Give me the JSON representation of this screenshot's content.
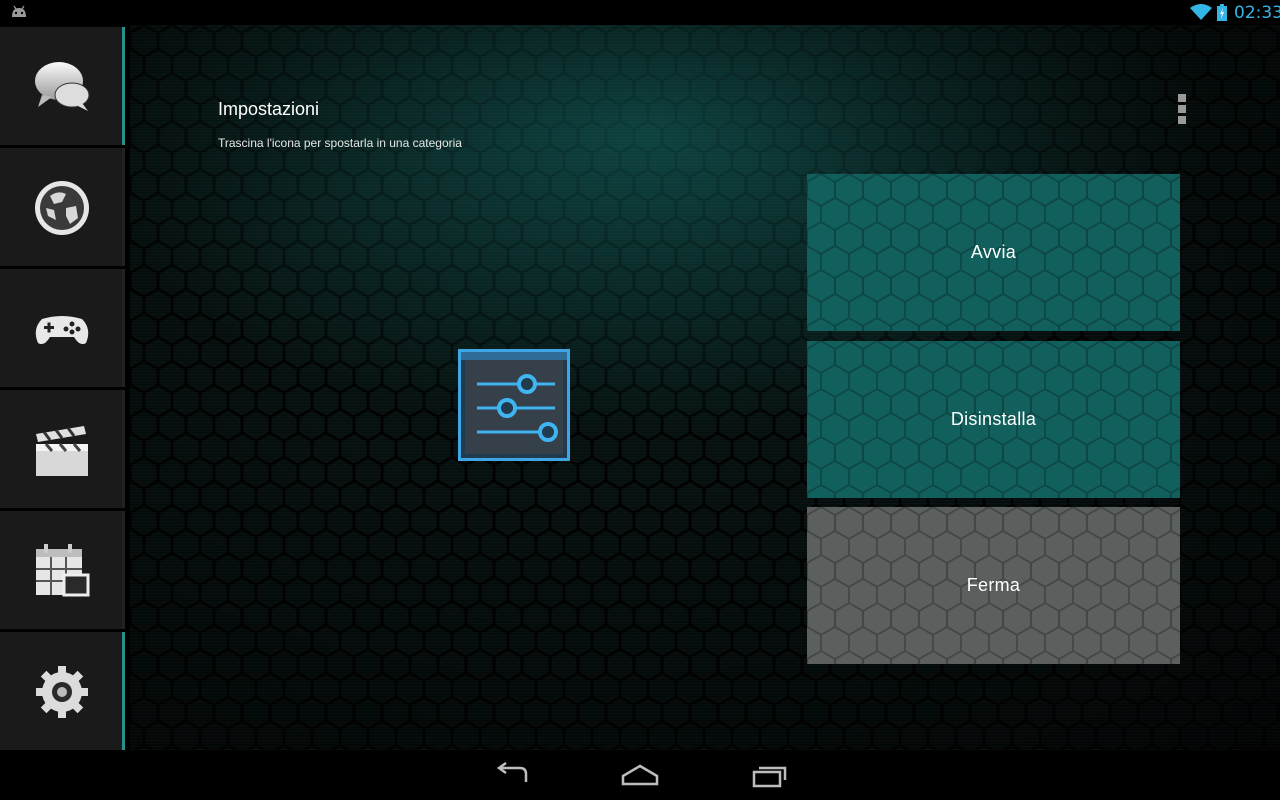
{
  "status_bar": {
    "time": "02:33",
    "left_icon": "android-icon",
    "icons": [
      "wifi-icon",
      "battery-charging-icon"
    ],
    "accent": "#33b5e5"
  },
  "sidebar": {
    "items": [
      {
        "name": "chat",
        "icon": "chat-bubbles-icon"
      },
      {
        "name": "internet",
        "icon": "globe-icon"
      },
      {
        "name": "games",
        "icon": "gamepad-icon"
      },
      {
        "name": "media",
        "icon": "clapperboard-icon"
      },
      {
        "name": "tools",
        "icon": "calendar-grid-icon"
      },
      {
        "name": "settings",
        "icon": "gear-icon"
      }
    ]
  },
  "header": {
    "title": "Impostazioni",
    "subtitle": "Trascina l'icona per spostarla in una categoria"
  },
  "dragged_app": {
    "icon": "settings-sliders-icon"
  },
  "actions": {
    "start": "Avvia",
    "uninstall": "Disinstalla",
    "stop": "Ferma"
  },
  "colors": {
    "drop_teal": "#12605d",
    "drop_gray": "#5b5f5e",
    "sidebar_accent": "#2b8f8c"
  },
  "nav_bar": {
    "buttons": [
      "back-icon",
      "home-icon",
      "recents-icon"
    ]
  }
}
